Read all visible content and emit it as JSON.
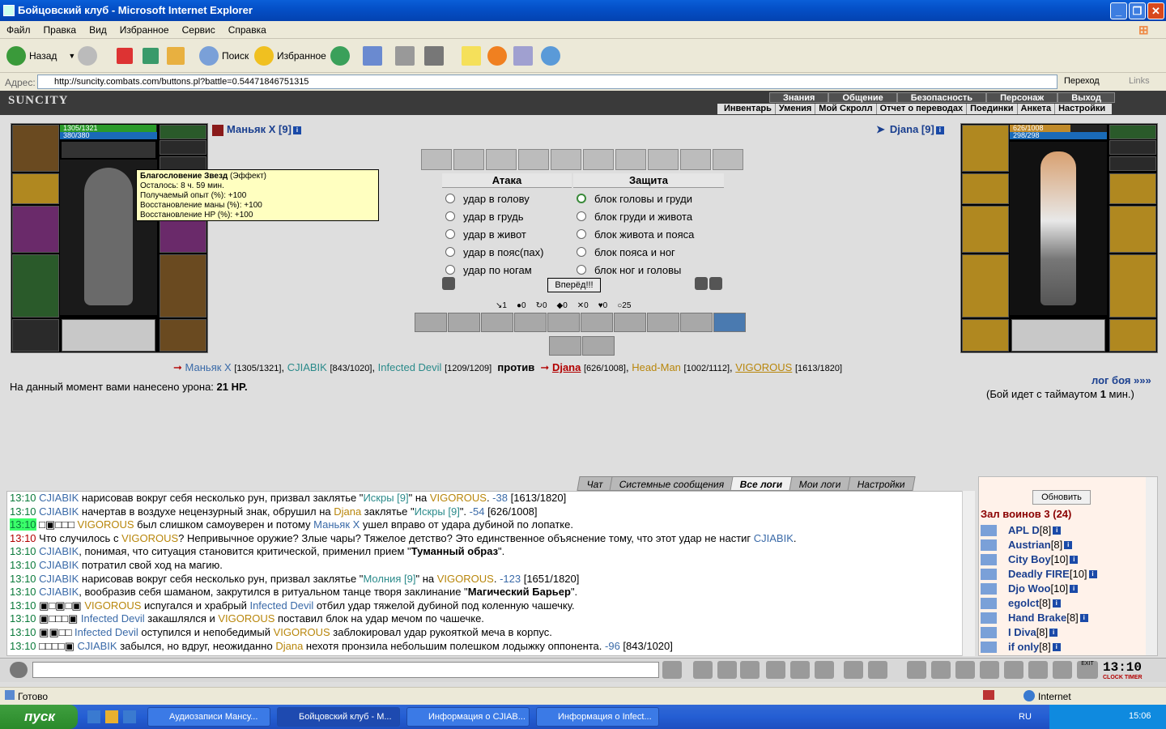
{
  "window": {
    "title": "Бойцовский клуб - Microsoft Internet Explorer"
  },
  "menu": [
    "Файл",
    "Правка",
    "Вид",
    "Избранное",
    "Сервис",
    "Справка"
  ],
  "toolbar": {
    "back": "Назад",
    "search": "Поиск",
    "favorites": "Избранное"
  },
  "address": {
    "label": "Адрес:",
    "url": "http://suncity.combats.com/buttons.pl?battle=0.54471846751315",
    "go": "Переход",
    "links": "Links"
  },
  "site": {
    "logo": "SUNCITY",
    "nav1": [
      "Знания",
      "Общение",
      "Безопасность",
      "Персонаж",
      "Выход"
    ],
    "nav2": [
      "Инвентарь",
      "Умения",
      "Мой Скролл",
      "Отчет о переводах",
      "Поединки",
      "Анкета",
      "Настройки"
    ]
  },
  "player": {
    "name": "Маньяк X [9]",
    "hp": "1305/1321",
    "mana": "380/380",
    "hp_fraction": 0.988
  },
  "opponent": {
    "name": "Djana [9]",
    "hp": "626/1008",
    "mana": "298/298",
    "hp_fraction": 0.621
  },
  "tooltip": {
    "title": "Благословение Звезд",
    "title_suffix": " (Эффект)",
    "lines": [
      "Осталось: 8 ч. 59 мин.",
      "Получаемый опыт (%): +100",
      "Восстановление маны (%): +100",
      "Восстановление HP (%): +100"
    ]
  },
  "battle": {
    "attack_header": "Атака",
    "defense_header": "Защита",
    "attacks": [
      "удар в голову",
      "удар в грудь",
      "удар в живот",
      "удар в пояс(пах)",
      "удар по ногам"
    ],
    "defenses": [
      "блок головы и груди",
      "блок груди и живота",
      "блок живота и пояса",
      "блок пояса и ног",
      "блок ног и головы"
    ],
    "forward": "Вперёд!!!",
    "counters": [
      "1",
      "0",
      "0",
      "0",
      "0",
      "0",
      "25"
    ]
  },
  "fight": {
    "team1": [
      {
        "name": "Маньяк X",
        "hp": "[1305/1321]"
      },
      {
        "name": "CJIABIK",
        "hp": "[843/1020]"
      },
      {
        "name": "Infected Devil",
        "hp": "[1209/1209]"
      }
    ],
    "vs": "против",
    "team2": [
      {
        "name": "Djana",
        "hp": "[626/1008]"
      },
      {
        "name": "Head-Man",
        "hp": "[1002/1112]"
      },
      {
        "name": "VIGOROUS",
        "hp": "[1613/1820]"
      }
    ],
    "damage_text": "На данный момент вами нанесено урона:",
    "damage_value": "21 HP.",
    "log_link": "лог боя »»»",
    "timeout_pre": "(Бой идет с таймаутом ",
    "timeout_val": "1",
    "timeout_post": " мин.)"
  },
  "log_tabs": [
    "Чат",
    "Системные сообщения",
    "Все логи",
    "Мои логи",
    "Настройки"
  ],
  "log": [
    {
      "t": "13:10",
      "html": "<span class='bl'>CJIABIK</span> нарисовав вокруг себя несколько рун, призвал заклятье \"<span class='cy'>Искры [9]</span>\" на <span class='gd'>VIGOROUS</span>. <span class='bl'>-38</span> [1613/1820]"
    },
    {
      "t": "13:10",
      "html": "<span class='bl'>CJIABIK</span> начертав в воздухе нецензурный знак, обрушил на <span class='gd'>Djana</span> заклятье \"<span class='cy'>Искры [9]</span>\". <span class='bl'>-54</span> [626/1008]"
    },
    {
      "t": "13:10",
      "hl": true,
      "html": "□▣□□□ <span class='gd'>VIGOROUS</span> был слишком самоуверен и потому <span class='bl'>Маньяк X</span> ушел вправо от удара дубиной по лопатке."
    },
    {
      "t": "13:10",
      "red": true,
      "html": "Что случилось с <span class='gd'>VIGOROUS</span>? Непривычное оружие? Злые чары? Тяжелое детство? Это единственное объяснение тому, что этот удар не настиг <span class='bl'>CJIABIK</span>."
    },
    {
      "t": "13:10",
      "html": "<span class='bl'>CJIABIK</span>, понимая, что ситуация становится критической, применил прием \"<b>Туманный образ</b>\"."
    },
    {
      "t": "13:10",
      "html": "<span class='bl'>CJIABIK</span> потратил свой ход на магию."
    },
    {
      "t": "13:10",
      "html": "<span class='bl'>CJIABIK</span> нарисовав вокруг себя несколько рун, призвал заклятье \"<span class='cy'>Молния [9]</span>\" на <span class='gd'>VIGOROUS</span>. <span class='bl'>-123</span> [1651/1820]"
    },
    {
      "t": "13:10",
      "html": "<span class='bl'>CJIABIK</span>, вообразив себя шаманом, закрутился в ритуальном танце творя заклинание \"<b>Магический Барьер</b>\"."
    },
    {
      "t": "13:10",
      "html": "▣□▣□▣ <span class='gd'>VIGOROUS</span> испугался и храбрый <span class='bl'>Infected Devil</span> отбил удар тяжелой дубиной под коленную чашечку."
    },
    {
      "t": "13:10",
      "html": "▣□□□▣ <span class='bl'>Infected Devil</span> закашлялся и <span class='gd'>VIGOROUS</span> поставил блок на удар мечом по чашечке."
    },
    {
      "t": "13:10",
      "html": "▣▣□□ <span class='bl'>Infected Devil</span> оступился и непобедимый <span class='gd'>VIGOROUS</span> заблокировал удар рукояткой меча в корпус."
    },
    {
      "t": "13:10",
      "html": "□□□□▣ <span class='bl'>CJIABIK</span> забылся, но вдруг, неожиданно <span class='gd'>Djana</span> нехотя пронзила небольшим полешком лодыжку оппонента. <span class='bl'>-96</span> [843/1020]"
    }
  ],
  "room": {
    "refresh": "Обновить",
    "title": "Зал воинов 3 (24)",
    "players": [
      {
        "name": "APL D",
        "lvl": "[8]"
      },
      {
        "name": "Austrian",
        "lvl": "[8]"
      },
      {
        "name": "City Boy",
        "lvl": "[10]"
      },
      {
        "name": "Deadly FIRE",
        "lvl": "[10]"
      },
      {
        "name": "Djo Woo",
        "lvl": "[10]"
      },
      {
        "name": "egolct",
        "lvl": "[8]"
      },
      {
        "name": "Hand Brake",
        "lvl": "[8]"
      },
      {
        "name": "I Diva",
        "lvl": "[8]"
      },
      {
        "name": "if only",
        "lvl": "[8]"
      }
    ]
  },
  "clock": "13:10",
  "clock_label": "CLOCK TIMER",
  "exit_label": "EXIT",
  "status": {
    "left": "Готово",
    "zone": "Internet"
  },
  "taskbar": {
    "start": "пуск",
    "tasks": [
      "Аудиозаписи Мансу...",
      "Бойцовский клуб - М...",
      "Информация о CJIAB...",
      "Информация о Infect..."
    ],
    "lang": "RU",
    "time": "15:06"
  }
}
